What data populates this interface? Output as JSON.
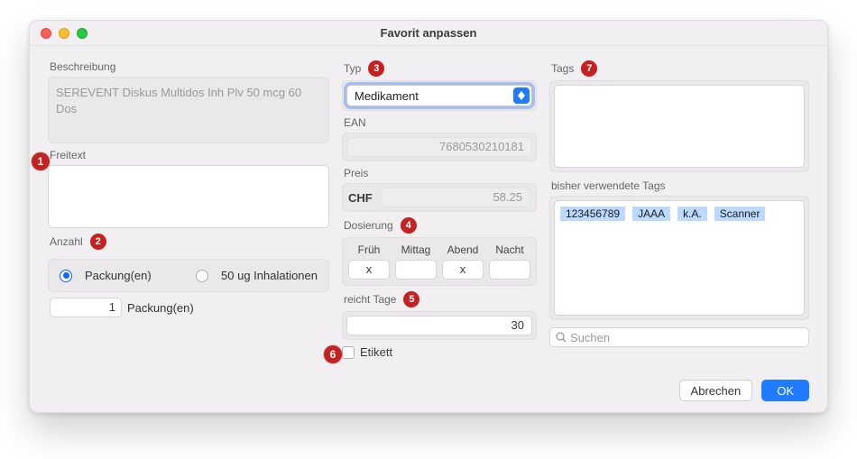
{
  "window": {
    "title": "Favorit anpassen"
  },
  "col1": {
    "beschreibung_label": "Beschreibung",
    "beschreibung_value": "SEREVENT Diskus Multidos Inh Plv 50 mcg 60 Dos",
    "freitext_label": "Freitext",
    "freitext_value": "",
    "anzahl_label": "Anzahl",
    "radio1_label": "Packung(en)",
    "radio2_label": "50 ug Inhalationen",
    "qty_value": "1",
    "qty_unit": "Packung(en)"
  },
  "col2": {
    "typ_label": "Typ",
    "typ_value": "Medikament",
    "ean_label": "EAN",
    "ean_value": "7680530210181",
    "preis_label": "Preis",
    "chf_label": "CHF",
    "preis_value": "58.25",
    "dosierung_label": "Dosierung",
    "dos_headers": [
      "Früh",
      "Mittag",
      "Abend",
      "Nacht"
    ],
    "dos_values": [
      "x",
      "",
      "x",
      ""
    ],
    "reicht_label": "reicht Tage",
    "reicht_value": "30",
    "etikett_label": "Etikett"
  },
  "col3": {
    "tags_label": "Tags",
    "used_label": "bisher verwendete Tags",
    "used_tags": [
      "123456789",
      "JAAA",
      "k.A.",
      "Scanner"
    ],
    "search_placeholder": "Suchen"
  },
  "footer": {
    "cancel": "Abrechen",
    "ok": "OK"
  },
  "badges": {
    "b1": "1",
    "b2": "2",
    "b3": "3",
    "b4": "4",
    "b5": "5",
    "b6": "6",
    "b7": "7"
  }
}
